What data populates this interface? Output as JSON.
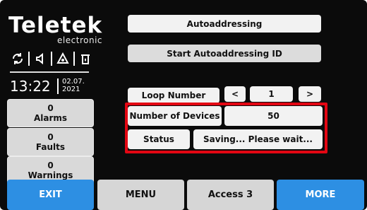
{
  "brand": {
    "logo_text": "Teletek",
    "logo_subtitle": "electronic"
  },
  "status_icons": [
    "sync-icon",
    "speaker-icon",
    "siren-icon",
    "fire-door-icon"
  ],
  "clock": {
    "time": "13:22",
    "date_line1": "02.07.",
    "date_line2": "2021"
  },
  "sidebar": {
    "alarms": {
      "count": "0",
      "label": "Alarms"
    },
    "faults": {
      "count": "0",
      "label": "Faults"
    },
    "warnings": {
      "count": "0",
      "label": "Warnings"
    }
  },
  "main": {
    "autoaddressing_label": "Autoaddressing",
    "start_autoaddressing_label": "Start Autoaddressing ID",
    "loop_number_label": "Loop Number",
    "loop_prev": "<",
    "loop_value": "1",
    "loop_next": ">",
    "number_of_devices_label": "Number of Devices",
    "number_of_devices_value": "50",
    "status_label": "Status",
    "status_value": "Saving... Please wait..."
  },
  "bottom_bar": {
    "exit": "EXIT",
    "menu": "MENU",
    "access": "Access 3",
    "more": "MORE"
  },
  "colors": {
    "accent_blue": "#2d8fe3",
    "highlight_red": "#e30613",
    "background": "#0b0b0b"
  }
}
